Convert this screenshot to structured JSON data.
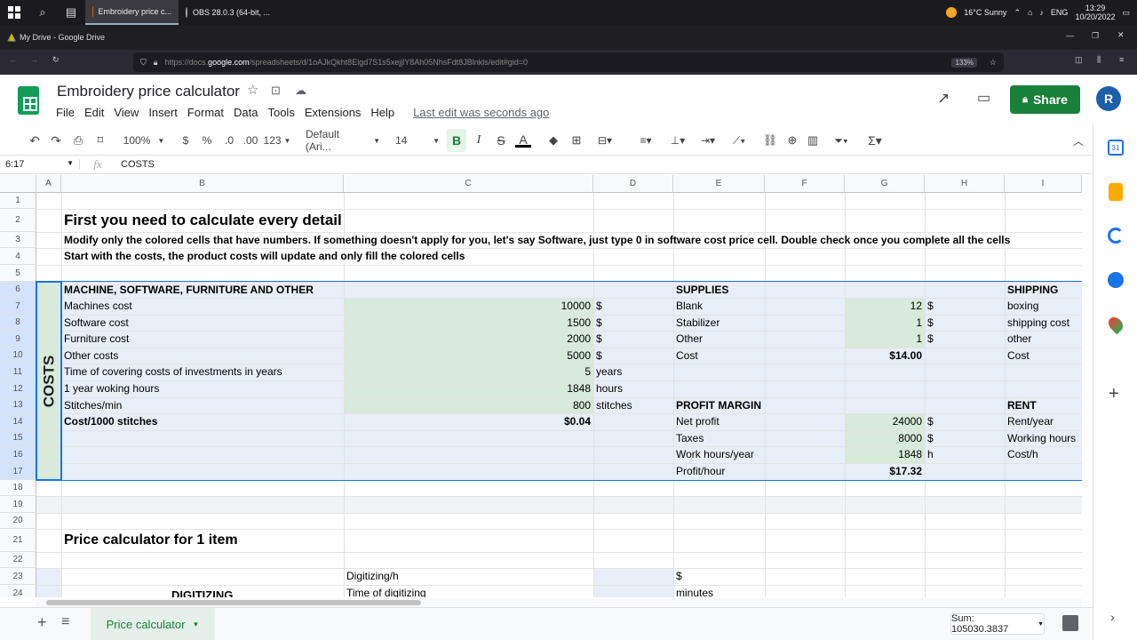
{
  "taskbar": {
    "apps": [
      {
        "label": "Embroidery price c..."
      },
      {
        "label": "OBS 28.0.3 (64-bit, ..."
      }
    ],
    "weather": "16°C  Sunny",
    "lang": "ENG",
    "time": "13:29",
    "date": "10/20/2022"
  },
  "browser": {
    "window_title": "My Drive - Google Drive",
    "url_prefix": "https://docs.",
    "url_domain": "google.com",
    "url_rest": "/spreadsheets/d/1oAJkQkht8Elgd7S1s5xejjlY8Ah05NhsFdt8JBlnkls/edit#gid=0",
    "zoom": "133%"
  },
  "doc": {
    "title": "Embroidery price calculator",
    "menus": [
      "File",
      "Edit",
      "View",
      "Insert",
      "Format",
      "Data",
      "Tools",
      "Extensions",
      "Help"
    ],
    "last_edit": "Last edit was seconds ago",
    "share_label": "Share",
    "avatar_letter": "R"
  },
  "toolbar": {
    "zoom": "100%",
    "currency": "$",
    "percent": "%",
    "dec_less": ".0",
    "dec_more": ".00",
    "num_format": "123",
    "font": "Default (Ari...",
    "font_size": "14"
  },
  "formula": {
    "cell_ref": "6:17",
    "fx": "fx",
    "value": "COSTS"
  },
  "columns": [
    "A",
    "B",
    "C",
    "D",
    "E",
    "F",
    "G",
    "H",
    "I"
  ],
  "rows": [
    "1",
    "2",
    "3",
    "4",
    "5",
    "6",
    "7",
    "8",
    "9",
    "10",
    "11",
    "12",
    "13",
    "14",
    "15",
    "16",
    "17",
    "18",
    "19",
    "20",
    "21",
    "22",
    "23",
    "24"
  ],
  "sheet": {
    "heading": "First you need to calculate every detail",
    "note1": "Modify only the colored cells that have numbers. If something doesn't apply for you, let's say Software, just type 0 in software cost price cell. Double check once you complete all the cells",
    "note2": "Start with the costs, the product costs will update and only fill the colored cells",
    "costs_label": "COSTS",
    "machine_header": "MACHINE, SOFTWARE, FURNITURE AND OTHER",
    "machine_rows": [
      {
        "label": "Machines cost",
        "value": "10000",
        "unit": "$"
      },
      {
        "label": "Software cost",
        "value": "1500",
        "unit": "$"
      },
      {
        "label": "Furniture cost",
        "value": "2000",
        "unit": "$"
      },
      {
        "label": "Other costs",
        "value": "5000",
        "unit": "$"
      },
      {
        "label": "Time of covering costs of investments in years",
        "value": "5",
        "unit": "years"
      },
      {
        "label": "1 year woking hours",
        "value": "1848",
        "unit": "hours"
      },
      {
        "label": "Stitches/min",
        "value": "800",
        "unit": "stitches"
      },
      {
        "label": "Cost/1000 stitches",
        "value": "$0.04",
        "unit": ""
      }
    ],
    "supplies_header": "SUPPLIES",
    "supplies_rows": [
      {
        "label": "Blank",
        "value": "12",
        "unit": "$"
      },
      {
        "label": "Stabilizer",
        "value": "1",
        "unit": "$"
      },
      {
        "label": "Other",
        "value": "1",
        "unit": "$"
      },
      {
        "label": "Cost",
        "value": "$14.00",
        "unit": ""
      }
    ],
    "profit_header": "PROFIT MARGIN",
    "profit_rows": [
      {
        "label": "Net profit",
        "value": "24000",
        "unit": "$"
      },
      {
        "label": "Taxes",
        "value": "8000",
        "unit": "$"
      },
      {
        "label": "Work hours/year",
        "value": "1848",
        "unit": "h"
      },
      {
        "label": "Profit/hour",
        "value": "$17.32",
        "unit": ""
      }
    ],
    "shipping_header": "SHIPPING",
    "shipping_rows": [
      "boxing",
      "shipping cost",
      "other",
      "Cost"
    ],
    "rent_header": "RENT",
    "rent_rows": [
      "Rent/year",
      "Working hours",
      "Cost/h"
    ],
    "price_heading": "Price calculator for 1 item",
    "digitizing_label": "DIGITIZING",
    "digitizing_h": "Digitizing/h",
    "digitizing_h_unit": "$",
    "time_digitizing": "Time of digitizing",
    "time_digitizing_unit": "minutes"
  },
  "bottom": {
    "sheet_tab": "Price calculator",
    "sum": "Sum: 105030.3837"
  },
  "colors": {
    "brand_green": "#188038",
    "cell_blue": "#e8eef8",
    "cell_green": "#d8ead9",
    "selection": "#1a73e8"
  }
}
